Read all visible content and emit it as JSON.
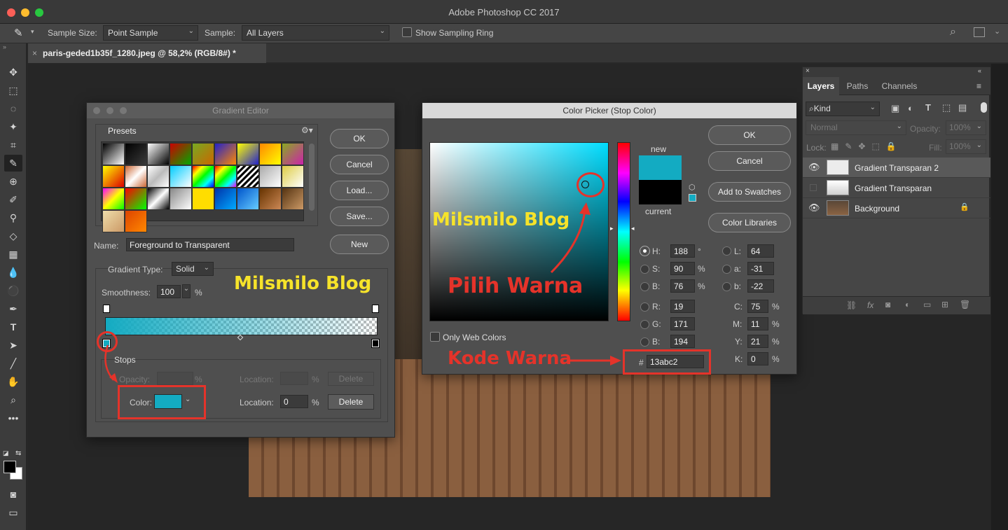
{
  "app": {
    "title": "Adobe Photoshop CC 2017"
  },
  "options": {
    "sample_size_label": "Sample Size:",
    "sample_size_value": "Point Sample",
    "sample_label": "Sample:",
    "sample_value": "All Layers",
    "show_sampling_ring": "Show Sampling Ring"
  },
  "document": {
    "tab_title": "paris-geded1b35f_1280.jpeg @ 58,2% (RGB/8#) *"
  },
  "gradient_editor": {
    "title": "Gradient Editor",
    "presets_label": "Presets",
    "buttons": {
      "ok": "OK",
      "cancel": "Cancel",
      "load": "Load...",
      "save": "Save...",
      "new": "New"
    },
    "name_label": "Name:",
    "name_value": "Foreground to Transparent",
    "gradient_type_label": "Gradient Type:",
    "gradient_type_value": "Solid",
    "smoothness_label": "Smoothness:",
    "smoothness_value": "100",
    "percent": "%",
    "stops_label": "Stops",
    "opacity_label": "Opacity:",
    "location_label": "Location:",
    "delete_label": "Delete",
    "color_label": "Color:",
    "location_value": "0",
    "stop_color": "#13abc2"
  },
  "color_picker": {
    "title": "Color Picker (Stop Color)",
    "new_label": "new",
    "current_label": "current",
    "buttons": {
      "ok": "OK",
      "cancel": "Cancel",
      "add_to_swatches": "Add to Swatches",
      "color_libraries": "Color Libraries"
    },
    "only_web_colors": "Only Web Colors",
    "fields": {
      "H": {
        "label": "H:",
        "value": "188",
        "unit": "°"
      },
      "S": {
        "label": "S:",
        "value": "90",
        "unit": "%"
      },
      "B": {
        "label": "B:",
        "value": "76",
        "unit": "%"
      },
      "R": {
        "label": "R:",
        "value": "19"
      },
      "G": {
        "label": "G:",
        "value": "171"
      },
      "Bl": {
        "label": "B:",
        "value": "194"
      },
      "L": {
        "label": "L:",
        "value": "64"
      },
      "a": {
        "label": "a:",
        "value": "-31"
      },
      "b": {
        "label": "b:",
        "value": "-22"
      },
      "C": {
        "label": "C:",
        "value": "75",
        "unit": "%"
      },
      "M": {
        "label": "M:",
        "value": "11",
        "unit": "%"
      },
      "Y": {
        "label": "Y:",
        "value": "21",
        "unit": "%"
      },
      "K": {
        "label": "K:",
        "value": "0",
        "unit": "%"
      }
    },
    "hex_label": "#",
    "hex_value": "13abc2",
    "new_color": "#13abc2",
    "current_color": "#000000"
  },
  "annotations": {
    "blog1": "Milsmilo Blog",
    "blog2": "Milsmilo Blog",
    "pilih": "Pilih Warna",
    "kode": "Kode Warna",
    "color": "#e5332a",
    "text_yellow": "#f6e32a"
  },
  "layers_panel": {
    "tabs": [
      "Layers",
      "Paths",
      "Channels"
    ],
    "kind_label": "Kind",
    "blend_mode": "Normal",
    "opacity_label": "Opacity:",
    "opacity_value": "100%",
    "lock_label": "Lock:",
    "fill_label": "Fill:",
    "fill_value": "100%",
    "layers": [
      {
        "name": "Gradient Transparan 2",
        "visible": true
      },
      {
        "name": "Gradient Transparan",
        "visible": false
      },
      {
        "name": "Background",
        "visible": true,
        "locked": true
      }
    ]
  }
}
